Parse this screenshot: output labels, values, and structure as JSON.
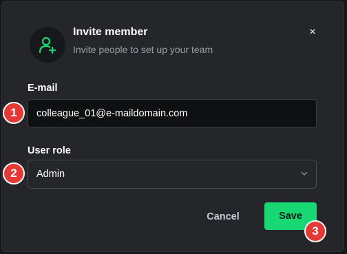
{
  "dialog": {
    "title": "Invite member",
    "subtitle": "Invite people to set up your team",
    "close_icon": "×",
    "icon": "user-plus-icon"
  },
  "form": {
    "email_label": "E-mail",
    "email_value": "colleague_01@e-maildomain.com",
    "role_label": "User role",
    "role_value": "Admin"
  },
  "actions": {
    "cancel_label": "Cancel",
    "save_label": "Save"
  },
  "markers": [
    "1",
    "2",
    "3"
  ],
  "colors": {
    "accent": "#17d873",
    "marker": "#e53935",
    "background": "#24262a"
  }
}
